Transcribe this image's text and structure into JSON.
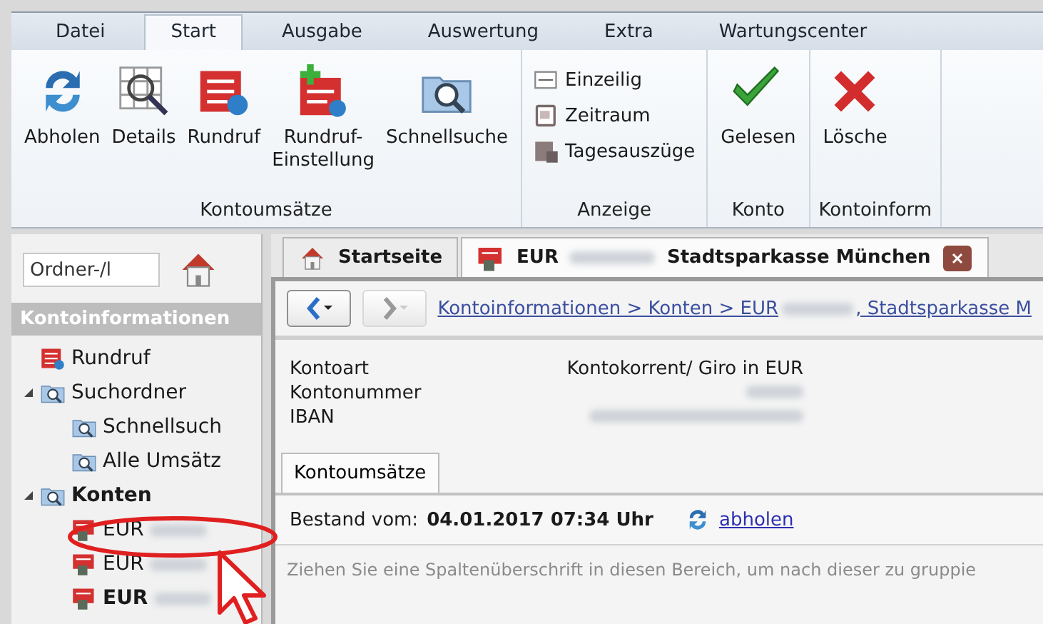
{
  "menu_tabs": [
    {
      "label": "Datei",
      "selected": false
    },
    {
      "label": "Start",
      "selected": true
    },
    {
      "label": "Ausgabe",
      "selected": false
    },
    {
      "label": "Auswertung",
      "selected": false
    },
    {
      "label": "Extra",
      "selected": false
    },
    {
      "label": "Wartungscenter",
      "selected": false
    }
  ],
  "ribbon_groups": [
    {
      "title": "Kontoumsätze",
      "kind": "large",
      "items": [
        {
          "label": "Abholen"
        },
        {
          "label": "Details"
        },
        {
          "label": "Rundruf"
        },
        {
          "label": "Rundruf-\nEinstellung"
        },
        {
          "label": "Schnellsuche"
        }
      ]
    },
    {
      "title": "Anzeige",
      "kind": "small",
      "items": [
        {
          "label": "Einzeilig"
        },
        {
          "label": "Zeitraum"
        },
        {
          "label": "Tagesauszüge"
        }
      ]
    },
    {
      "title": "Konto",
      "kind": "large",
      "items": [
        {
          "label": "Gelesen"
        }
      ]
    },
    {
      "title": "Kontoinform",
      "kind": "large",
      "items": [
        {
          "label": "Lösche"
        }
      ]
    }
  ],
  "sidebar": {
    "search": {
      "placeholder": "Ordner-/l"
    },
    "header": "Kontoinformationen",
    "tree": [
      {
        "label": "Rundruf",
        "kind": "broadcast",
        "bold": false
      },
      {
        "label": "Suchordner",
        "kind": "search-folder",
        "bold": false,
        "expanded": true,
        "children": [
          {
            "label": "Schnellsuch",
            "kind": "search-folder",
            "bold": false
          },
          {
            "label": "Alle Umsätz",
            "kind": "search-folder",
            "bold": false
          }
        ]
      },
      {
        "label": "Konten",
        "kind": "account-folder",
        "bold": true,
        "expanded": true,
        "children": [
          {
            "label": "EUR",
            "kind": "account",
            "bold": false
          },
          {
            "label": "EUR",
            "kind": "account",
            "bold": false
          },
          {
            "label": "EUR",
            "kind": "account",
            "bold": true
          }
        ]
      }
    ]
  },
  "doc_tabs": [
    {
      "label": "Startseite",
      "selected": false
    },
    {
      "label": "EUR",
      "selected": true,
      "suffix": "Stadtsparkasse München"
    }
  ],
  "breadcrumb": {
    "before": "Kontoinformationen > Konten > EUR",
    "after": ", Stadtsparkasse M"
  },
  "details": [
    {
      "label": "Kontoart",
      "value": "Kontokorrent/ Giro in EUR"
    },
    {
      "label": "Kontonummer"
    },
    {
      "label": "IBAN"
    }
  ],
  "inner_tabs": [
    {
      "label": "Kontoumsätze",
      "selected": true
    }
  ],
  "balance": {
    "label": "Bestand vom:",
    "date": "04.01.2017 07:34 Uhr",
    "link": "abholen"
  },
  "group_hint": "Ziehen Sie eine Spaltenüberschrift in diesen Bereich, um nach dieser zu gruppie"
}
